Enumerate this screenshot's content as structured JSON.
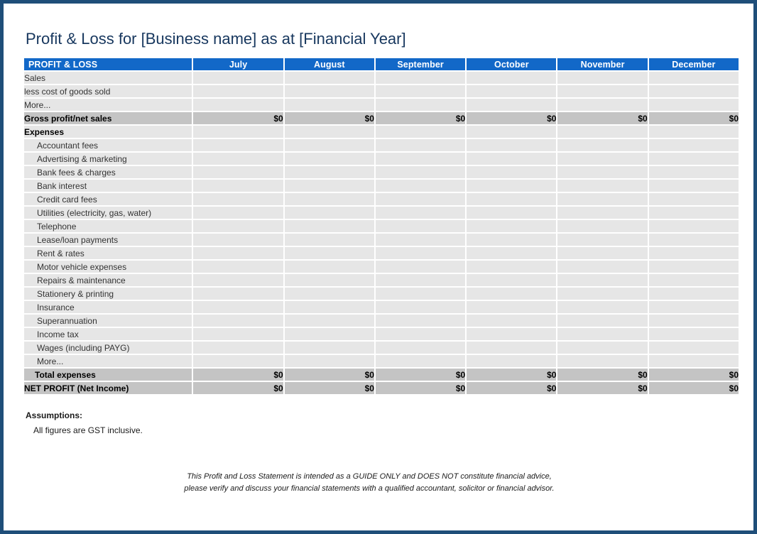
{
  "document": {
    "title": "Profit & Loss for [Business name] as at [Financial Year]"
  },
  "table": {
    "columns": [
      "PROFIT & LOSS",
      "July",
      "August",
      "September",
      "October",
      "November",
      "December"
    ],
    "rows": [
      {
        "label": "Sales",
        "style": "item-plain",
        "values": [
          "",
          "",
          "",
          "",
          "",
          ""
        ]
      },
      {
        "label": "less cost of goods sold",
        "style": "item-plain",
        "values": [
          "",
          "",
          "",
          "",
          "",
          ""
        ]
      },
      {
        "label": "More...",
        "style": "item-plain",
        "values": [
          "",
          "",
          "",
          "",
          "",
          ""
        ]
      },
      {
        "label": "Gross profit/net sales",
        "style": "subtotal",
        "values": [
          "$0",
          "$0",
          "$0",
          "$0",
          "$0",
          "$0"
        ]
      },
      {
        "label": "Expenses",
        "style": "section",
        "values": [
          "",
          "",
          "",
          "",
          "",
          ""
        ]
      },
      {
        "label": "Accountant fees",
        "style": "item-indent",
        "values": [
          "",
          "",
          "",
          "",
          "",
          ""
        ]
      },
      {
        "label": "Advertising & marketing",
        "style": "item-indent",
        "values": [
          "",
          "",
          "",
          "",
          "",
          ""
        ]
      },
      {
        "label": "Bank fees & charges",
        "style": "item-indent",
        "values": [
          "",
          "",
          "",
          "",
          "",
          ""
        ]
      },
      {
        "label": "Bank interest",
        "style": "item-indent",
        "values": [
          "",
          "",
          "",
          "",
          "",
          ""
        ]
      },
      {
        "label": "Credit card fees",
        "style": "item-indent",
        "values": [
          "",
          "",
          "",
          "",
          "",
          ""
        ]
      },
      {
        "label": "Utilities (electricity, gas, water)",
        "style": "item-indent",
        "values": [
          "",
          "",
          "",
          "",
          "",
          ""
        ]
      },
      {
        "label": "Telephone",
        "style": "item-indent",
        "values": [
          "",
          "",
          "",
          "",
          "",
          ""
        ]
      },
      {
        "label": "Lease/loan payments",
        "style": "item-indent",
        "values": [
          "",
          "",
          "",
          "",
          "",
          ""
        ]
      },
      {
        "label": "Rent & rates",
        "style": "item-indent",
        "values": [
          "",
          "",
          "",
          "",
          "",
          ""
        ]
      },
      {
        "label": "Motor vehicle expenses",
        "style": "item-indent",
        "values": [
          "",
          "",
          "",
          "",
          "",
          ""
        ]
      },
      {
        "label": "Repairs & maintenance",
        "style": "item-indent",
        "values": [
          "",
          "",
          "",
          "",
          "",
          ""
        ]
      },
      {
        "label": "Stationery & printing",
        "style": "item-indent",
        "values": [
          "",
          "",
          "",
          "",
          "",
          ""
        ]
      },
      {
        "label": "Insurance",
        "style": "item-indent",
        "values": [
          "",
          "",
          "",
          "",
          "",
          ""
        ]
      },
      {
        "label": "Superannuation",
        "style": "item-indent",
        "values": [
          "",
          "",
          "",
          "",
          "",
          ""
        ]
      },
      {
        "label": "Income tax",
        "style": "item-indent",
        "values": [
          "",
          "",
          "",
          "",
          "",
          ""
        ]
      },
      {
        "label": "Wages (including PAYG)",
        "style": "item-indent",
        "values": [
          "",
          "",
          "",
          "",
          "",
          ""
        ]
      },
      {
        "label": "More...",
        "style": "item-indent",
        "values": [
          "",
          "",
          "",
          "",
          "",
          ""
        ]
      },
      {
        "label": "Total expenses",
        "style": "total",
        "values": [
          "$0",
          "$0",
          "$0",
          "$0",
          "$0",
          "$0"
        ]
      },
      {
        "label": "NET PROFIT (Net Income)",
        "style": "netprofit",
        "values": [
          "$0",
          "$0",
          "$0",
          "$0",
          "$0",
          "$0"
        ]
      }
    ]
  },
  "assumptions": {
    "heading": "Assumptions:",
    "lines": [
      "All figures are GST inclusive."
    ]
  },
  "disclaimer": {
    "line1": "This Profit and Loss Statement is intended as a GUIDE ONLY and DOES NOT constitute financial advice,",
    "line2": "please verify and discuss your financial statements with a qualified accountant, solicitor or financial advisor."
  },
  "colors": {
    "border": "#1F4E79",
    "header_blue": "#1268C8",
    "cell_grey": "#E6E6E6",
    "total_grey": "#C4C4C4",
    "title_navy": "#17375E"
  }
}
